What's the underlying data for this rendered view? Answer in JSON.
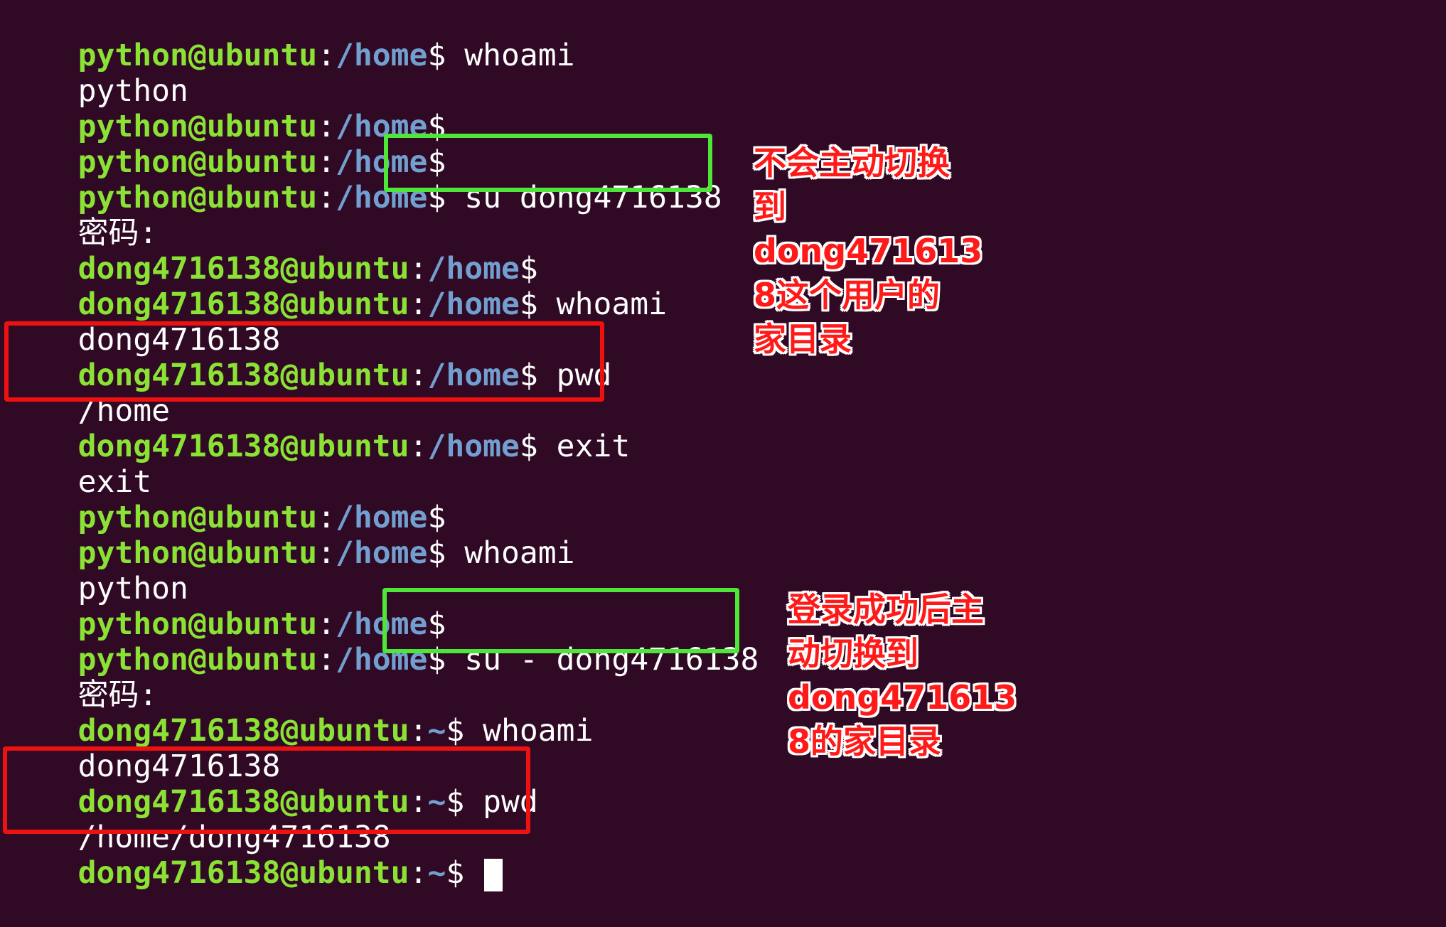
{
  "terminal": {
    "background": "#300a24",
    "prompt_user_color": "#8ae234",
    "prompt_path_color": "#729fcf",
    "lines": [
      {
        "type": "prompt",
        "user": "python@ubuntu",
        "path": "/home",
        "cmd": " whoami"
      },
      {
        "type": "output",
        "text": "python"
      },
      {
        "type": "prompt",
        "user": "python@ubuntu",
        "path": "/home",
        "cmd": ""
      },
      {
        "type": "prompt",
        "user": "python@ubuntu",
        "path": "/home",
        "cmd": ""
      },
      {
        "type": "prompt",
        "user": "python@ubuntu",
        "path": "/home",
        "cmd": " su dong4716138"
      },
      {
        "type": "output",
        "text": "密码:"
      },
      {
        "type": "prompt",
        "user": "dong4716138@ubuntu",
        "path": "/home",
        "cmd": ""
      },
      {
        "type": "prompt",
        "user": "dong4716138@ubuntu",
        "path": "/home",
        "cmd": " whoami"
      },
      {
        "type": "output",
        "text": "dong4716138"
      },
      {
        "type": "prompt",
        "user": "dong4716138@ubuntu",
        "path": "/home",
        "cmd": " pwd"
      },
      {
        "type": "output",
        "text": "/home"
      },
      {
        "type": "prompt",
        "user": "dong4716138@ubuntu",
        "path": "/home",
        "cmd": " exit"
      },
      {
        "type": "output",
        "text": "exit"
      },
      {
        "type": "prompt",
        "user": "python@ubuntu",
        "path": "/home",
        "cmd": ""
      },
      {
        "type": "prompt",
        "user": "python@ubuntu",
        "path": "/home",
        "cmd": " whoami"
      },
      {
        "type": "output",
        "text": "python"
      },
      {
        "type": "prompt",
        "user": "python@ubuntu",
        "path": "/home",
        "cmd": ""
      },
      {
        "type": "prompt",
        "user": "python@ubuntu",
        "path": "/home",
        "cmd": " su - dong4716138"
      },
      {
        "type": "output",
        "text": "密码:"
      },
      {
        "type": "prompt",
        "user": "dong4716138@ubuntu",
        "path": "~",
        "cmd": " whoami"
      },
      {
        "type": "output",
        "text": "dong4716138"
      },
      {
        "type": "prompt",
        "user": "dong4716138@ubuntu",
        "path": "~",
        "cmd": " pwd"
      },
      {
        "type": "output",
        "text": "/home/dong4716138"
      },
      {
        "type": "prompt",
        "user": "dong4716138@ubuntu",
        "path": "~",
        "cmd": " ",
        "cursor": true
      }
    ]
  },
  "annotations": {
    "box_green_color": "#4fe63a",
    "box_red_color": "#ee1111",
    "note_color": "#ff1a1a",
    "note1": "不会主动切换\n到\ndong471613\n8这个用户的\n家目录",
    "note2": "登录成功后主\n动切换到\ndong471613\n8的家目录"
  }
}
